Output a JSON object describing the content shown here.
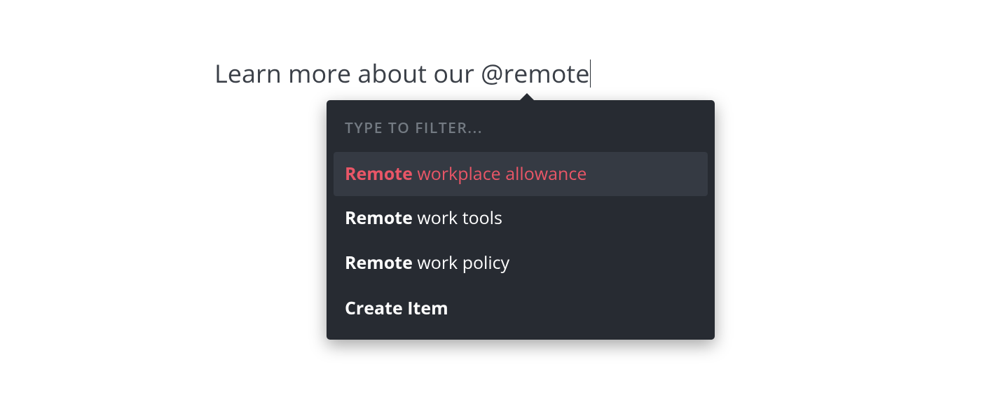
{
  "editor": {
    "prefix": "Learn more about our ",
    "mention": "@remote"
  },
  "dropdown": {
    "header": "TYPE TO FILTER...",
    "items": [
      {
        "match": "Remote",
        "rest": " workplace allowance",
        "selected": true
      },
      {
        "match": "Remote",
        "rest": " work tools",
        "selected": false
      },
      {
        "match": "Remote",
        "rest": " work policy",
        "selected": false
      }
    ],
    "action": "Create Item"
  }
}
